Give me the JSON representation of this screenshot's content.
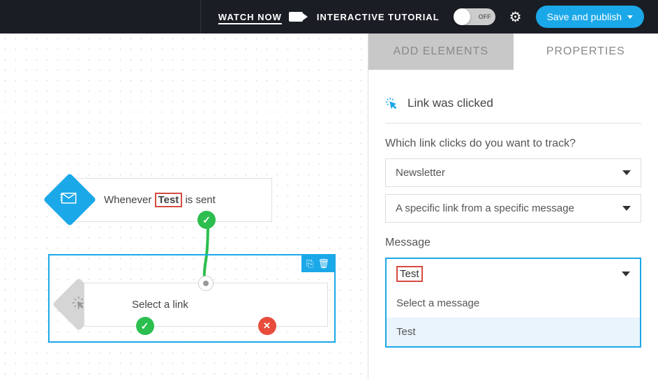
{
  "header": {
    "watch_now": "WATCH NOW",
    "tutorial_label": "INTERACTIVE TUTORIAL",
    "toggle_state": "OFF",
    "save_btn": "Save and publish"
  },
  "tabs": {
    "add_elements": "ADD ELEMENTS",
    "properties": "PROPERTIES"
  },
  "properties": {
    "title": "Link was clicked",
    "track_label": "Which link clicks do you want to track?",
    "newsletter": "Newsletter",
    "specific_link": "A specific link from a specific message",
    "message_label": "Message",
    "message_current": "Test",
    "options": {
      "placeholder": "Select a message",
      "test": "Test"
    }
  },
  "canvas": {
    "node1": {
      "prefix": "Whenever ",
      "highlight": "Test",
      "suffix": " is sent"
    },
    "node2": {
      "label": "Select a link"
    }
  }
}
